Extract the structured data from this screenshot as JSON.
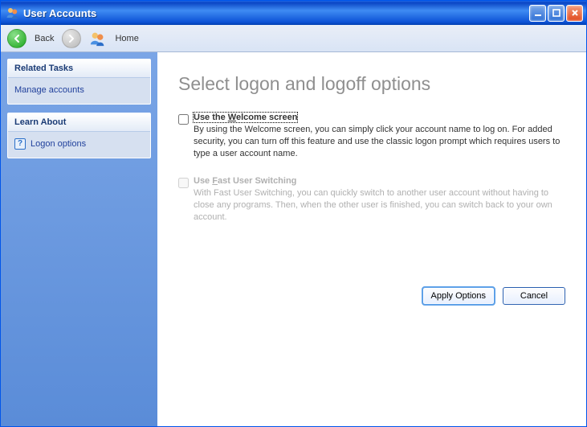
{
  "titlebar": {
    "title": "User Accounts"
  },
  "toolbar": {
    "back_label": "Back",
    "home_label": "Home"
  },
  "sidebar": {
    "related_tasks_header": "Related Tasks",
    "related_tasks_items": {
      "manage_accounts": "Manage accounts"
    },
    "learn_about_header": "Learn About",
    "learn_about_items": {
      "logon_options": "Logon options"
    }
  },
  "content": {
    "heading": "Select logon and logoff options",
    "option1": {
      "checked": false,
      "title_pre": "Use the ",
      "title_access": "W",
      "title_post": "elcome screen",
      "desc": "By using the Welcome screen, you can simply click your account name to log on. For added security, you can turn off this feature and use the classic logon prompt which requires users to type a user account name."
    },
    "option2": {
      "checked": false,
      "disabled": true,
      "title_pre": "Use ",
      "title_access": "F",
      "title_post": "ast User Switching",
      "desc": "With Fast User Switching, you can quickly switch to another user account without having to close any programs. Then, when the other user is finished, you can switch back to your own account."
    },
    "buttons": {
      "apply": "Apply Options",
      "cancel": "Cancel"
    }
  }
}
